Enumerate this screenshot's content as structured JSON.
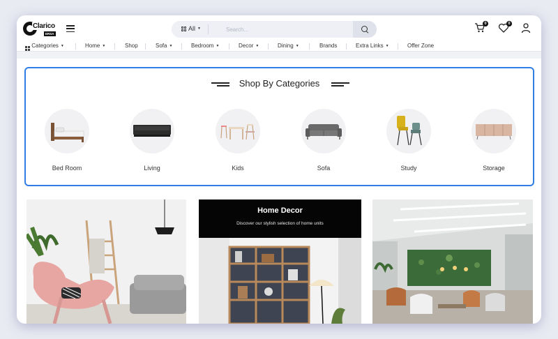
{
  "header": {
    "logo_text": "Clarico",
    "logo_badge": "ERSA",
    "search": {
      "category_label": "All",
      "placeholder": "Search..."
    },
    "cart_count": "0",
    "wishlist_count": "0"
  },
  "nav": {
    "items": [
      {
        "label": "Categories",
        "caret": true
      },
      {
        "label": "Home",
        "caret": true
      },
      {
        "label": "Shop",
        "caret": false
      },
      {
        "label": "Sofa",
        "caret": true
      },
      {
        "label": "Bedroom",
        "caret": true
      },
      {
        "label": "Decor",
        "caret": true
      },
      {
        "label": "Dining",
        "caret": true
      },
      {
        "label": "Brands",
        "caret": false
      },
      {
        "label": "Extra Links",
        "caret": true
      },
      {
        "label": "Offer Zone",
        "caret": false
      }
    ]
  },
  "categories": {
    "title": "Shop By Categories",
    "items": [
      {
        "label": "Bed Room",
        "icon": "bed-icon"
      },
      {
        "label": "Living",
        "icon": "tv-unit-icon"
      },
      {
        "label": "Kids",
        "icon": "kids-table-icon"
      },
      {
        "label": "Sofa",
        "icon": "sofa-icon"
      },
      {
        "label": "Study",
        "icon": "study-chairs-icon"
      },
      {
        "label": "Storage",
        "icon": "sideboard-icon"
      }
    ]
  },
  "banners": {
    "home_decor": {
      "title": "Home Decor",
      "subtitle": "Discover our stylish selection of home units"
    }
  },
  "colors": {
    "accent_border": "#2f7ee6",
    "search_bg": "#eef0f6",
    "dark": "#050505"
  }
}
